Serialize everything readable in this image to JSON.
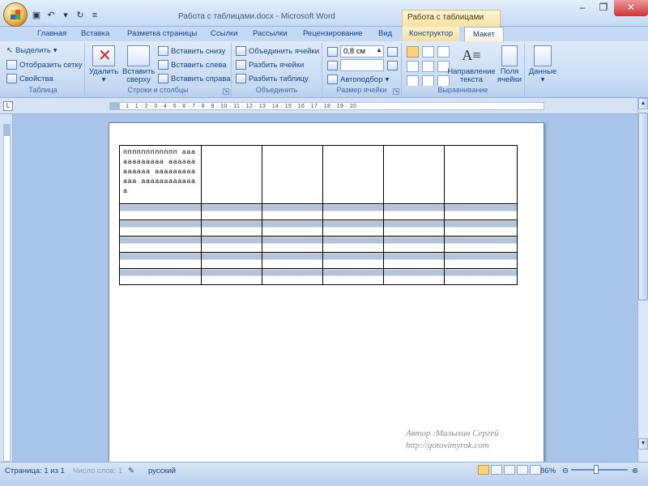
{
  "window": {
    "title": "Работа с таблицами.docx - Microsoft Word",
    "context_title": "Работа с таблицами"
  },
  "tabs": [
    "Главная",
    "Вставка",
    "Разметка страницы",
    "Ссылки",
    "Рассылки",
    "Рецензирование",
    "Вид",
    "Конструктор",
    "Макет"
  ],
  "ribbon": {
    "table": {
      "label": "Таблица",
      "select": "Выделить",
      "show_grid": "Отобразить сетку",
      "properties": "Свойства"
    },
    "rows_cols": {
      "label": "Строки и столбцы",
      "delete": "Удалить",
      "insert_above_1": "Вставить",
      "insert_above_2": "сверху",
      "insert_below": "Вставить снизу",
      "insert_left": "Вставить слева",
      "insert_right": "Вставить справа"
    },
    "merge": {
      "label": "Объединить",
      "merge_cells": "Объединить ячейки",
      "split_cells": "Разбить ячейки",
      "split_table": "Разбить таблицу"
    },
    "cell_size": {
      "label": "Размер ячейки",
      "height_value": "0,8 см",
      "autofit": "Автоподбор"
    },
    "alignment": {
      "label": "Выравнивание",
      "text_direction_1": "Направление",
      "text_direction_2": "текста",
      "margins_1": "Поля",
      "margins_2": "ячейки"
    },
    "data": {
      "label": "Данные"
    }
  },
  "ruler": {
    "corner": "L",
    "marks": "· 1 · 1 · 2 · 3 · 4 · 5 · 6 · 7 · 8 · 9 · 10 · 11 · 12 · 13 · 14 · 15 · 16 · 17 · 18 · 19 · 20"
  },
  "document": {
    "cell_text": "пппппппппппп аааааааааааа аааааааааааа аааааааааааа аааааааааааа а",
    "author_line": "Автор :Малыхин Сергей",
    "url_line": "http://gotovimyrok.com"
  },
  "status": {
    "page": "Страница: 1 из 1",
    "words": "Число слов: 1",
    "language": "русский",
    "zoom": "86%"
  }
}
